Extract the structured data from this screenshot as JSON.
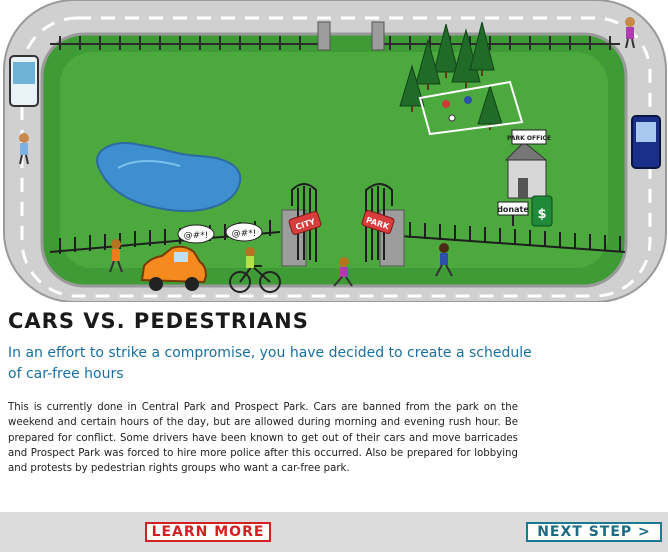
{
  "scene": {
    "gate_left_sign": "CITY",
    "gate_right_sign": "PARK",
    "office_sign": "PARK OFFICE",
    "donate_sign": "donate",
    "donation_box_symbol": "$",
    "speech_bubble_driver": "@#*!",
    "speech_bubble_cyclist": "@#*!",
    "colors": {
      "grass": "#3f9b35",
      "road": "#d0d0d0",
      "lake": "#3d8fd0",
      "car": "#f58a1f"
    }
  },
  "content": {
    "title": "Cars vs. Pedestrians",
    "subtitle": "In an effort to strike a compromise, you have decided to create a schedule of car-free hours",
    "body": "This is currently done in Central Park and Prospect Park. Cars are banned from the park on the weekend and certain hours of the day, but are allowed during morning and evening rush hour. Be prepared for conflict. Some drivers have been known to get out of their cars and move barricades and Prospect Park was forced to hire more police after this occurred. Also be prepared for lobbying and protests by pedestrian rights groups who want a car-free park."
  },
  "footer": {
    "learn_more": "LEARN MORE",
    "next_step": "NEXT STEP >"
  }
}
